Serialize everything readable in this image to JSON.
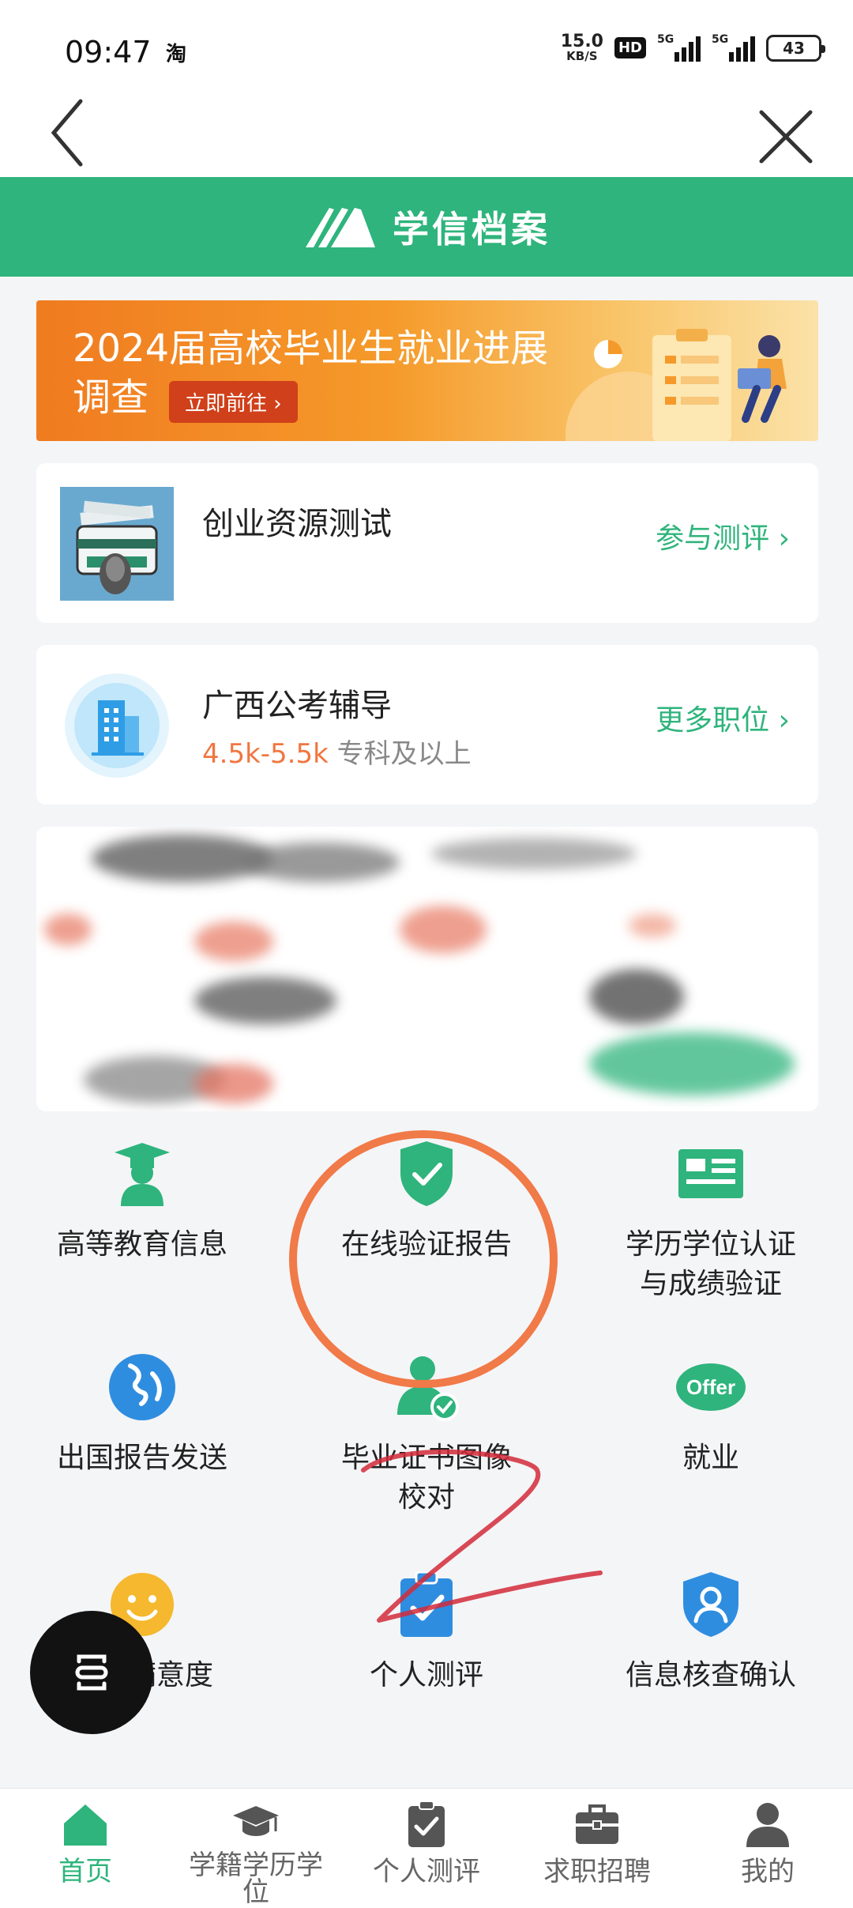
{
  "status_bar": {
    "time": "09:47",
    "app_indicator": "淘",
    "net_speed_value": "15.0",
    "net_speed_unit": "KB/S",
    "hd_badge": "HD",
    "signal_1_label": "5G",
    "signal_2_label": "5G",
    "battery": "43"
  },
  "nav": {
    "back_icon": "chevron-left-icon",
    "close_icon": "close-icon"
  },
  "brand": {
    "title": "学信档案",
    "logo_icon": "wings-logo-icon"
  },
  "banner": {
    "title": "2024届高校毕业生就业进展调查",
    "button_label": "立即前往 ›"
  },
  "cards": [
    {
      "title": "创业资源测试",
      "subtitle_salary": "",
      "subtitle_rest": "",
      "link_label": "参与测评 ›"
    },
    {
      "title": "广西公考辅导",
      "subtitle_salary": "4.5k-5.5k",
      "subtitle_rest": " 专科及以上",
      "link_label": "更多职位 ›"
    }
  ],
  "grid": [
    {
      "label": "高等教育信息",
      "icon": "graduate-icon"
    },
    {
      "label": "在线验证报告",
      "icon": "shield-check-icon"
    },
    {
      "label": "学历学位认证与成绩验证",
      "icon": "id-card-icon"
    },
    {
      "label": "出国报告发送",
      "icon": "globe-icon"
    },
    {
      "label": "毕业证书图像校对",
      "icon": "person-check-icon"
    },
    {
      "label": "就业",
      "icon": "offer-icon",
      "icon_text": "Offer"
    },
    {
      "label": "学校满意度",
      "icon": "smile-icon"
    },
    {
      "label": "个人测评",
      "icon": "clipboard-check-icon"
    },
    {
      "label": "信息核查确认",
      "icon": "shield-user-icon"
    }
  ],
  "tabs": [
    {
      "label": "首页",
      "icon": "home-icon",
      "active": true
    },
    {
      "label": "学籍学历学位",
      "icon": "mortarboard-icon",
      "active": false
    },
    {
      "label": "个人测评",
      "icon": "clipboard-check-icon",
      "active": false
    },
    {
      "label": "求职招聘",
      "icon": "briefcase-icon",
      "active": false
    },
    {
      "label": "我的",
      "icon": "user-icon",
      "active": false
    }
  ],
  "colors": {
    "brand_green": "#2eb47c",
    "banner_orange": "#f07b20",
    "annotation_orange": "#f07a48",
    "annotation_red": "#d22a3a"
  }
}
